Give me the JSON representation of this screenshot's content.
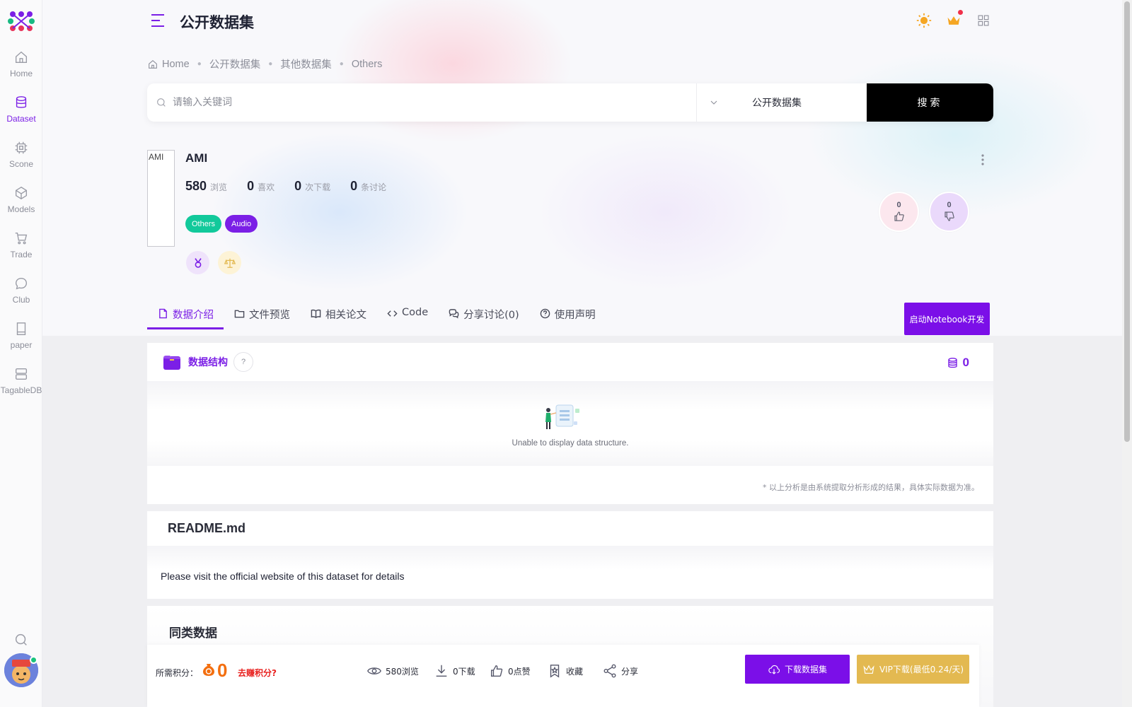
{
  "sidebar": {
    "items": [
      {
        "label": "Home",
        "icon": "home-icon",
        "active": false
      },
      {
        "label": "Dataset",
        "icon": "database-icon",
        "active": true
      },
      {
        "label": "Scone",
        "icon": "chip-icon",
        "active": false
      },
      {
        "label": "Models",
        "icon": "cube-icon",
        "active": false
      },
      {
        "label": "Trade",
        "icon": "cart-icon",
        "active": false
      },
      {
        "label": "Club",
        "icon": "chat-icon",
        "active": false
      },
      {
        "label": "paper",
        "icon": "book-icon",
        "active": false
      },
      {
        "label": "TagableDB",
        "icon": "server-icon",
        "active": false
      }
    ]
  },
  "header": {
    "title": "公开数据集"
  },
  "breadcrumb": {
    "home": "Home",
    "items": [
      "公开数据集",
      "其他数据集",
      "Others"
    ]
  },
  "search": {
    "placeholder": "请输入关键词",
    "value": "",
    "category": "公开数据集",
    "button": "搜索"
  },
  "dataset": {
    "thumb_alt": "AMI",
    "name": "AMI",
    "stats": [
      {
        "num": "580",
        "unit": "浏览"
      },
      {
        "num": "0",
        "unit": "喜欢"
      },
      {
        "num": "0",
        "unit": "次下载"
      },
      {
        "num": "0",
        "unit": "条讨论"
      }
    ],
    "tags": [
      {
        "label": "Others",
        "color": "#12c99b"
      },
      {
        "label": "Audio",
        "color": "#7b1fe6"
      }
    ],
    "likes": "0",
    "dislikes": "0"
  },
  "tabs": [
    {
      "label": "数据介绍",
      "icon": "file-icon",
      "active": true
    },
    {
      "label": "文件预览",
      "icon": "folder-icon",
      "active": false
    },
    {
      "label": "相关论文",
      "icon": "book-open-icon",
      "active": false
    },
    {
      "label": "Code",
      "icon": "code-icon",
      "active": false
    },
    {
      "label": "分享讨论(0)",
      "icon": "comments-icon",
      "active": false
    },
    {
      "label": "使用声明",
      "icon": "question-icon",
      "active": false
    }
  ],
  "notebook_button": "启动Notebook开发",
  "structure": {
    "title": "数据结构",
    "help": "?",
    "count": "0",
    "empty_text": "Unable to display data structure.",
    "note": "* 以上分析是由系统提取分析形成的结果，具体实际数据为准。"
  },
  "readme": {
    "title": "README.md",
    "text": "Please visit the official website of this dataset for details"
  },
  "similar": {
    "title": "同类数据"
  },
  "bottom_bar": {
    "need_label": "所需积分：",
    "points": "0",
    "earn_link": "去赚积分?",
    "views": "580浏览",
    "downloads": "0下载",
    "likes": "0点赞",
    "favorite": "收藏",
    "share": "分享",
    "download_button": "下载数据集",
    "vip_button": "VIP下载(最低0.24/天)"
  },
  "colors": {
    "accent": "#7b1fe6",
    "tag_green": "#12c99b",
    "vip_gold": "#e3b951",
    "coin_orange": "#f36f10",
    "earn_red": "#e8201e"
  }
}
